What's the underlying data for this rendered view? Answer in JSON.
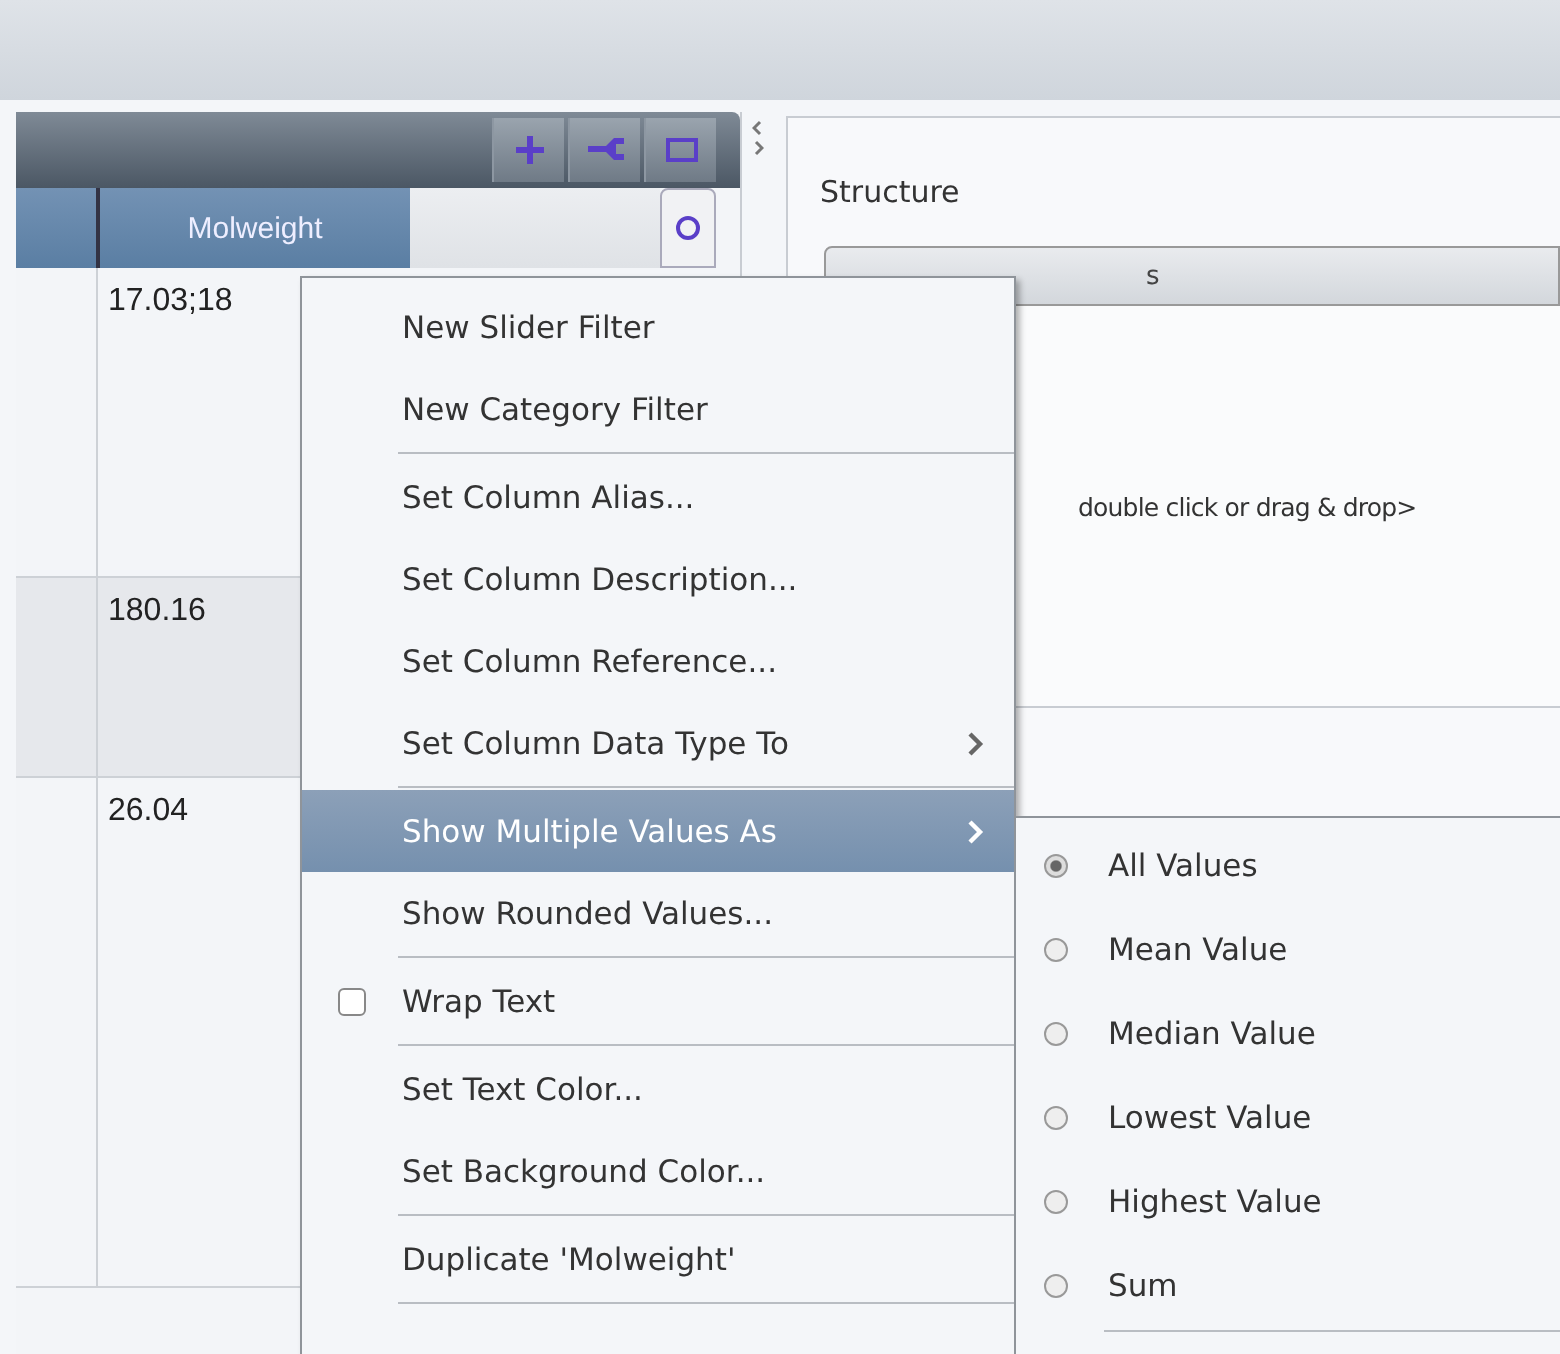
{
  "table": {
    "column_header": "Molweight",
    "rows": [
      {
        "value": "17.03;18",
        "shaded": false
      },
      {
        "value": "180.16",
        "shaded": true
      },
      {
        "value": "26.04",
        "shaded": false
      }
    ]
  },
  "side_panel": {
    "title": "Structure",
    "tab": "s",
    "hint": "double click or drag & drop>"
  },
  "context_menu": [
    {
      "kind": "item",
      "label": "New Slider Filter",
      "separator_after": false
    },
    {
      "kind": "item",
      "label": "New Category Filter",
      "separator_after": true
    },
    {
      "kind": "item",
      "label": "Set Column Alias...",
      "separator_after": false
    },
    {
      "kind": "item",
      "label": "Set Column Description...",
      "separator_after": false
    },
    {
      "kind": "item",
      "label": "Set Column Reference...",
      "separator_after": false
    },
    {
      "kind": "submenu",
      "label": "Set Column Data Type To",
      "separator_after": true,
      "highlighted": false
    },
    {
      "kind": "submenu",
      "label": "Show Multiple Values As",
      "separator_after": false,
      "highlighted": true
    },
    {
      "kind": "item",
      "label": "Show Rounded Values...",
      "separator_after": true
    },
    {
      "kind": "checkbox",
      "label": "Wrap Text",
      "separator_after": true,
      "checked": false
    },
    {
      "kind": "item",
      "label": "Set Text Color...",
      "separator_after": false
    },
    {
      "kind": "item",
      "label": "Set Background Color...",
      "separator_after": true
    },
    {
      "kind": "item",
      "label": "Duplicate 'Molweight'",
      "separator_after": true
    }
  ],
  "submenu": [
    {
      "label": "All Values",
      "selected": true
    },
    {
      "label": "Mean Value",
      "selected": false
    },
    {
      "label": "Median Value",
      "selected": false
    },
    {
      "label": "Lowest Value",
      "selected": false
    },
    {
      "label": "Highest Value",
      "selected": false
    },
    {
      "label": "Sum",
      "selected": false
    }
  ]
}
